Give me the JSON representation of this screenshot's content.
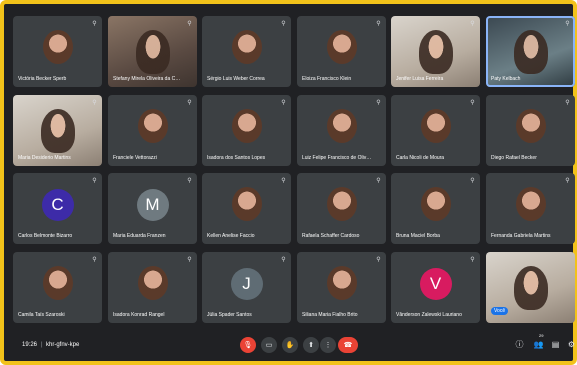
{
  "participants": [
    {
      "name": "Victória Becker Sperb",
      "avatar": "photo"
    },
    {
      "name": "Stefany Mirela Oliveira da Costa",
      "avatar": "video"
    },
    {
      "name": "Sérgio Luis Weber Correa",
      "avatar": "photo"
    },
    {
      "name": "Eloiza Francisco Klein",
      "avatar": "photo"
    },
    {
      "name": "Jenifer Luisa Ferreira",
      "avatar": "video"
    },
    {
      "name": "Paty Kelbach",
      "avatar": "video"
    },
    {
      "name": "Maria Desiderio Martins",
      "avatar": "video"
    },
    {
      "name": "Franciele Vettorazzi",
      "avatar": "photo"
    },
    {
      "name": "Isadora dos Santos Lopes",
      "avatar": "photo"
    },
    {
      "name": "Luiz Felipe Francisco de Oliveira",
      "avatar": "photo"
    },
    {
      "name": "Carla Nicoli de Moura",
      "avatar": "photo"
    },
    {
      "name": "Diego Rafael Becker",
      "avatar": "photo"
    },
    {
      "name": "Carlos Belmonte Bizarro",
      "avatar": "letter",
      "letter": "C",
      "color": "#3d2ba8"
    },
    {
      "name": "Maria Eduarda Franzen",
      "avatar": "letter",
      "letter": "M",
      "color": "#6f7a80"
    },
    {
      "name": "Kellen Anelise Faccio",
      "avatar": "photo"
    },
    {
      "name": "Rafaela Schaffer Cardoso",
      "avatar": "photo"
    },
    {
      "name": "Bruna Maciel Borba",
      "avatar": "photo"
    },
    {
      "name": "Fernanda Gabriela Martins",
      "avatar": "photo"
    },
    {
      "name": "Camila Taís Szaroski",
      "avatar": "photo"
    },
    {
      "name": "Isadora Konrad Rangel",
      "avatar": "photo"
    },
    {
      "name": "Júlia Spader Santos",
      "avatar": "letter",
      "letter": "J",
      "color": "#5f6c74"
    },
    {
      "name": "Siliana Maria Fialho Brito",
      "avatar": "photo"
    },
    {
      "name": "Vânderson Zalewski Lauriano",
      "avatar": "letter",
      "letter": "V",
      "color": "#d81b60"
    },
    {
      "name": "",
      "avatar": "video",
      "you_label": "Você"
    }
  ],
  "toolbar": {
    "time": "19:26",
    "separator": "|",
    "meeting_code": "khr-gfnv-kpe",
    "participant_count": "29",
    "controls": [
      {
        "name": "mic-off-icon",
        "glyph": "🎙"
      },
      {
        "name": "camera-icon",
        "glyph": "▭"
      },
      {
        "name": "raise-hand-icon",
        "glyph": "✋"
      },
      {
        "name": "present-screen-icon",
        "glyph": "⬆"
      },
      {
        "name": "more-options-icon",
        "glyph": "⋮"
      },
      {
        "name": "end-call-icon",
        "glyph": "☎"
      }
    ],
    "right_controls": [
      {
        "name": "info-icon",
        "glyph": "ⓘ"
      },
      {
        "name": "people-icon",
        "glyph": "👥"
      },
      {
        "name": "chat-icon",
        "glyph": "▤"
      },
      {
        "name": "activities-icon",
        "glyph": "⚙"
      }
    ]
  },
  "colors": {
    "frame": "#f2c21a",
    "background": "#202124",
    "tile": "#3c4043",
    "end_call": "#ea4335",
    "you_badge": "#1a73e8"
  }
}
